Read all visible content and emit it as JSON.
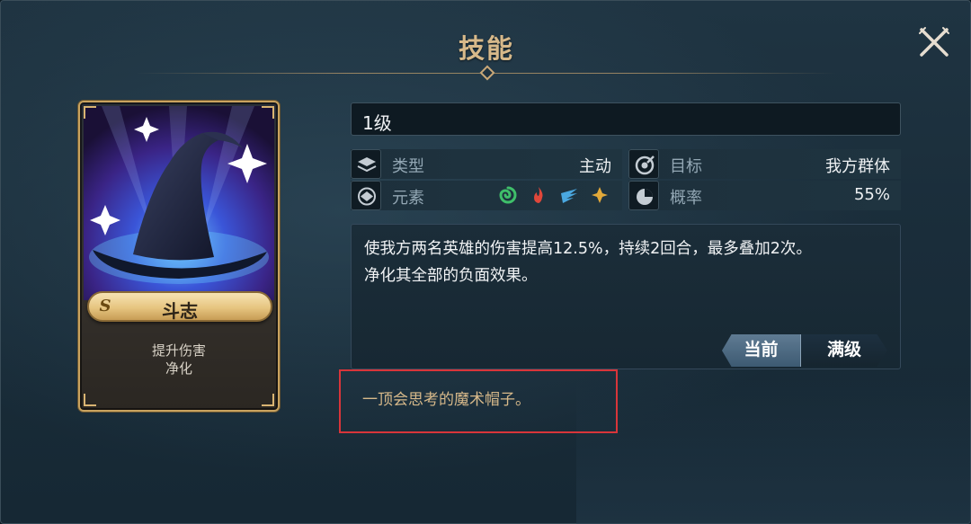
{
  "header": {
    "title": "技能"
  },
  "card": {
    "rank_badge": "S",
    "name": "斗志",
    "tags": [
      "提升伤害",
      "净化"
    ]
  },
  "level": {
    "label": "1级"
  },
  "info": {
    "type_label": "类型",
    "type_value": "主动",
    "target_label": "目标",
    "target_value": "我方群体",
    "element_label": "元素",
    "elements": [
      "wind-icon",
      "fire-icon",
      "water-icon",
      "light-icon"
    ],
    "chance_label": "概率",
    "chance_value": "55%"
  },
  "description": {
    "line1": "使我方两名英雄的伤害提高12.5%，持续2回合，最多叠加2次。",
    "line2": "净化其全部的负面效果。"
  },
  "tabs": {
    "current": "当前",
    "max": "满级"
  },
  "flavor": {
    "text": "一顶会思考的魔术帽子。"
  },
  "colors": {
    "title_gold": "#d7b98a",
    "card_border": "#c9a35f",
    "highlight_red": "#d8353a",
    "wind": "#3fbf6a",
    "fire": "#e0473a",
    "water": "#4aa8e0",
    "light": "#e2a93a"
  }
}
